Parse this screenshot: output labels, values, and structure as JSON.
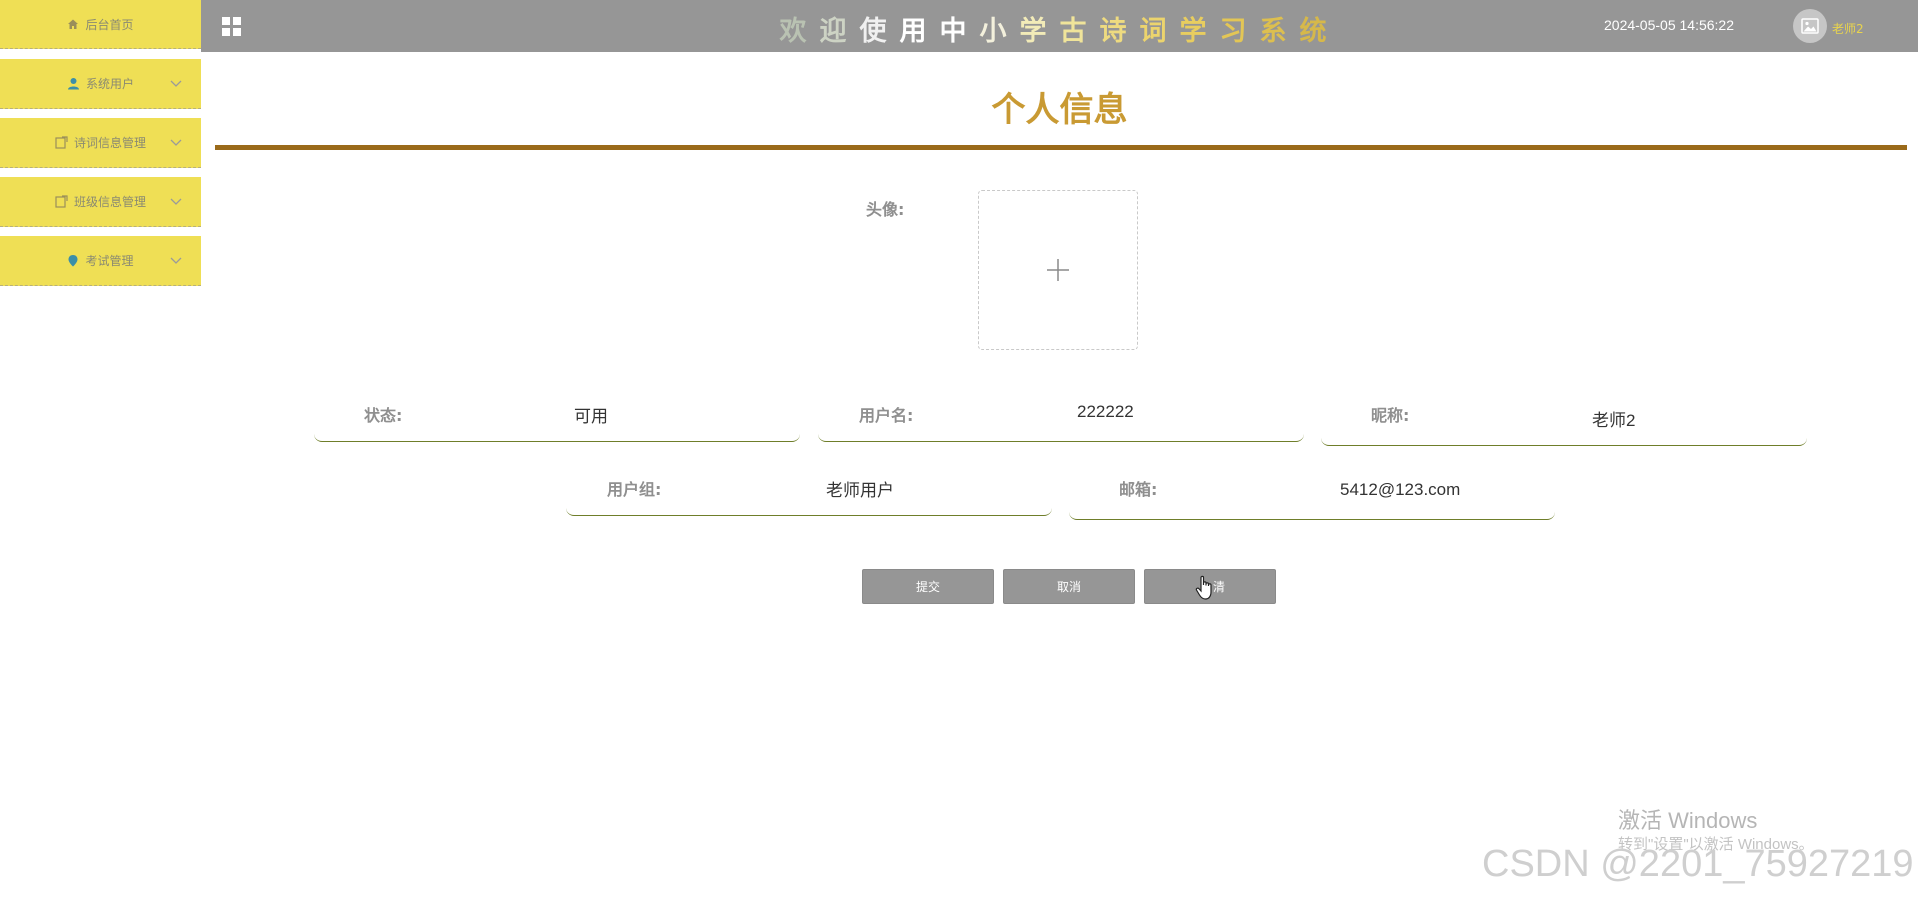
{
  "sidebar": {
    "items": [
      {
        "label": "后台首页",
        "icon": "home-icon",
        "expandable": false
      },
      {
        "label": "系统用户",
        "icon": "user-icon",
        "expandable": true
      },
      {
        "label": "诗词信息管理",
        "icon": "edit-icon",
        "expandable": true
      },
      {
        "label": "班级信息管理",
        "icon": "edit-icon",
        "expandable": true
      },
      {
        "label": "考试管理",
        "icon": "location-icon",
        "expandable": true
      }
    ]
  },
  "header": {
    "title_chars": [
      "欢",
      "迎",
      "使",
      "用",
      "中",
      "小",
      "学",
      "古",
      "诗",
      "词",
      "学",
      "习",
      "系",
      "统"
    ],
    "datetime": "2024-05-05 14:56:22",
    "username": "老师2"
  },
  "page": {
    "title": "个人信息"
  },
  "form": {
    "avatar_label": "头像:",
    "fields": [
      {
        "label": "状态:",
        "value": "可用"
      },
      {
        "label": "用户名:",
        "value": "222222"
      },
      {
        "label": "昵称:",
        "value": "老师2"
      },
      {
        "label": "用户组:",
        "value": "老师用户"
      },
      {
        "label": "邮箱:",
        "value": "5412@123.com"
      }
    ],
    "buttons": {
      "submit": "提交",
      "cancel": "取消",
      "third": "清"
    }
  },
  "watermark": {
    "activate_title": "激活 Windows",
    "activate_sub": "转到\"设置\"以激活 Windows。",
    "csdn": "CSDN @2201_75927219"
  },
  "colors": {
    "sidebar_bg": "#efdf55",
    "header_bg": "#969696",
    "page_title": "#c99a33",
    "title_line": "#9a6a1a",
    "field_underline": "#6f7e2a",
    "button_bg": "#969696"
  }
}
